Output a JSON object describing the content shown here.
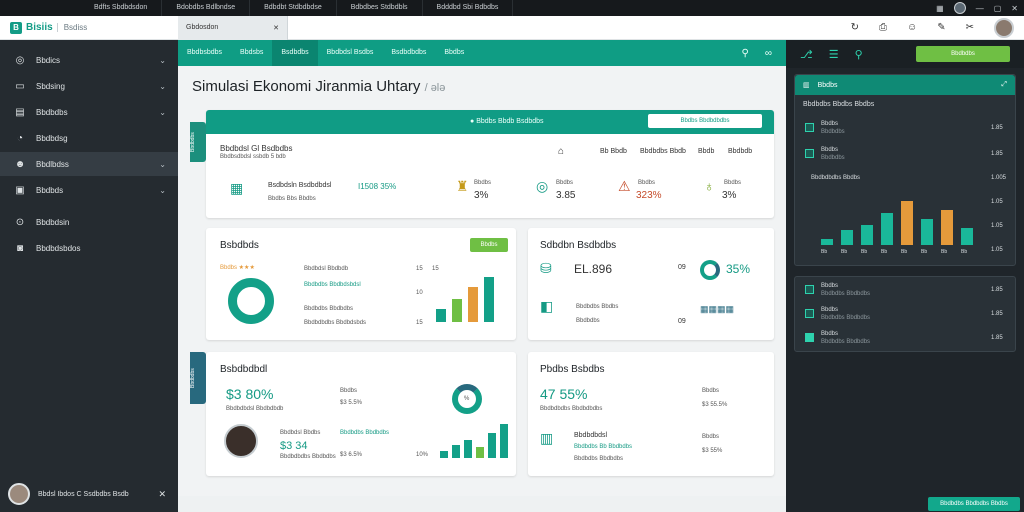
{
  "topbar": {
    "tabs": [
      "Bdfts Sbdbdsdon",
      "Bdobdbs Bdlbndse",
      "Bdbdbt Stdbdbdse",
      "Bdbdbes Stdbdbls",
      "Bdddbd Sbi Bdbdbs"
    ]
  },
  "app": {
    "name": "Bisiis",
    "subtitle": "Bsdiss"
  },
  "doc_tab": {
    "label": "Gbdosdon",
    "close": "✕"
  },
  "sidebar": {
    "items": [
      {
        "label": "Bbdics",
        "icon": "globe-icon",
        "chev": true
      },
      {
        "label": "Sbdsing",
        "icon": "briefcase-icon",
        "chev": true
      },
      {
        "label": "Bbdbdbs",
        "icon": "folder-icon",
        "chev": true
      },
      {
        "label": "Bbdbdsg",
        "icon": "clock-icon",
        "chev": false
      },
      {
        "label": "Bbdlbdss",
        "icon": "users-icon",
        "chev": true
      },
      {
        "label": "Bbdbds",
        "icon": "document-icon",
        "chev": true
      },
      {
        "label": "Bbdbdsin",
        "icon": "search-icon",
        "chev": false
      },
      {
        "label": "Bbdbdsbdos",
        "icon": "person-icon",
        "chev": false
      }
    ],
    "user_label": "Bbdsl Ibdos C Ssdbdbs Bsdb"
  },
  "nav": {
    "tabs": [
      "Bbdbsbdbs",
      "Bbdsbs",
      "Bsdbdbs",
      "Bbdbdsl Bsdbs",
      "Bsdbdbdbs",
      "Bbdbs"
    ]
  },
  "title": "Simulasi Ekonomi Jiranmia Uhtary",
  "title_tail": "/ ǝlə",
  "summary": {
    "tab_label": "Bbdbdbs",
    "head_label": "Bbdbs Bbdb Bsdbdbs",
    "head_button": "Bbdbs Bbdbdbdbs",
    "row_title": "Bbdbdsl Gl Bsdbdbs",
    "row_sub": "Bbdbsdbdsl ssbdb 5 bdb",
    "cols": [
      "Bb Bbdb",
      "Bbdbdbs Bbdb",
      "Bbdb",
      "Bbdbdb"
    ],
    "metric_label": "Bsdbdsln Bsdbdbdsl",
    "metric_value": "I1508 35%",
    "metric_sub": "Bbdbs Bbs Bbdbs",
    "kpis": [
      {
        "label": "Bbdbs",
        "value": "3%"
      },
      {
        "label": "Bbdbs",
        "value": "3.85"
      },
      {
        "label": "Bbdbs",
        "value": "323%"
      },
      {
        "label": "Bbdbs",
        "value": "3%"
      }
    ]
  },
  "card1": {
    "title": "Bsbdbds",
    "button": "Bbdbs",
    "stars": "Bbdbs ★★★",
    "rows": [
      "Bbdbdsl Bbdbdb",
      "Bbdbdbs Bbdbdsbdsl",
      "Bbdbdbs Bbdbdbs",
      "Bbdbdbdbs Bbdbdsbds"
    ],
    "axis": [
      "15",
      "10",
      "15",
      "15"
    ],
    "bars": [
      0.25,
      0.45,
      0.7,
      0.9
    ]
  },
  "card2": {
    "title": "Sdbdbn Bsdbdbs",
    "value1": "EL.896",
    "value1_tail": "09",
    "value2": "35%",
    "row_label": "Bbdbdbs Bbdbs",
    "row_sub": "Bbdbdbs",
    "row_tail": "09"
  },
  "card3": {
    "tab_label": "Bbdbdbs",
    "title": "Bsbdbdbdl",
    "value": "$3 80%",
    "value_sub": "Bbdbdbdsl Bbdbdbdb",
    "mid_label": "Bbdbs",
    "mid_value": "$3 5.5%",
    "ring_value": "%",
    "person_label": "Bbdbdsl Bbdbs",
    "person_value": "$3 34",
    "person_sub": "Bbdbdbdbs Bbdbdbs",
    "note": "Bbdbdbs Bbdbdbs",
    "note_val": "$3 6.5%",
    "axis": "10%",
    "bars": [
      0.2,
      0.35,
      0.5,
      0.3,
      0.7,
      0.95
    ]
  },
  "card4": {
    "title": "Pbdbs Bsbdbs",
    "value": "47 55%",
    "value_sub": "Bbdbdbdbs Bbdbdbdbs",
    "col_label": "Bbdbs",
    "col_value": "$3 55.5%",
    "row_label": "Bbdbdbdsl",
    "row_value": "Bbdbdbs Bb Bbdbdbs",
    "row_sub": "Bbdbdbs Bbdbdbs",
    "col2_label": "Bbdbs",
    "col2_value": "$3 55%"
  },
  "rpanel": {
    "button": "Bbdbdbs",
    "card1": {
      "head": "Bbdbs",
      "sub": "Bbdbdbs Bbdbs Bbdbs",
      "rows": [
        {
          "label": "Bbdbs",
          "sub": "Bbdbdbs",
          "val": "1.85"
        },
        {
          "label": "Bbdbs",
          "sub": "Bbdbdbs",
          "val": "1.85"
        }
      ],
      "chart_label": "Bbdbdbdbs Bbdbs",
      "axis": [
        "1.005",
        "1.05",
        "1.05",
        "1.05"
      ],
      "xticks": [
        "Bb",
        "Bb",
        "Bb",
        "Bb",
        "Bb",
        "Bb",
        "Bb",
        "Bb"
      ],
      "bars": [
        0.1,
        0.25,
        0.35,
        0.55,
        0.75,
        0.45,
        0.6,
        0.3
      ],
      "bar_colors": [
        "#1ab89a",
        "#1ab89a",
        "#1ab89a",
        "#1ab89a",
        "#e59a3b",
        "#1ab89a",
        "#e59a3b",
        "#1ab89a"
      ]
    },
    "card2": {
      "rows": [
        {
          "label": "Bbdbs",
          "sub": "Bbdbdbs Bbdbdbs",
          "val": "1.85"
        },
        {
          "label": "Bbdbs",
          "sub": "Bbdbdbs Bbdbdbs",
          "val": "1.85"
        },
        {
          "label": "Bbdbs",
          "sub": "Bbdbdbs Bbdbdbs",
          "val": "1.85"
        }
      ]
    },
    "footer_button": "Bbdbdbs Bbdbdbs Bbdbs"
  }
}
